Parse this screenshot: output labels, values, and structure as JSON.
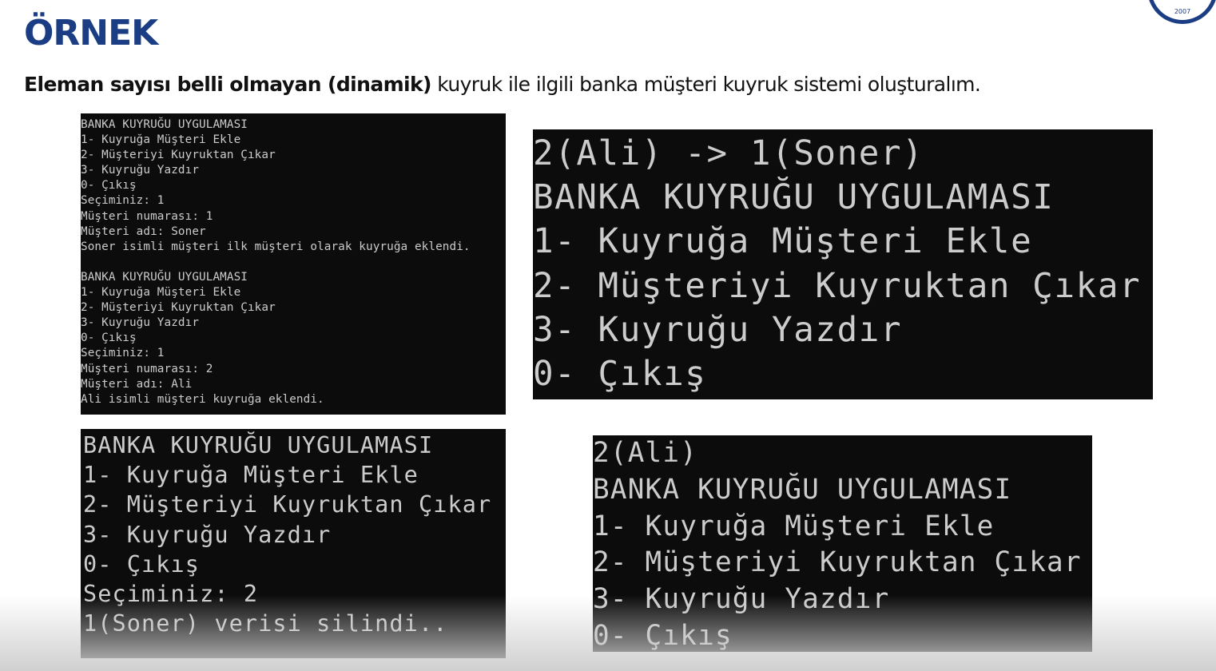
{
  "slide": {
    "title": "ÖRNEK",
    "subtitle_bold": "Eleman sayısı belli olmayan (dinamik)",
    "subtitle_rest": " kuyruk ile ilgili banka müşteri kuyruk sistemi oluşturalım."
  },
  "consoles": [
    {
      "lines": [
        "BANKA KUYRUĞU UYGULAMASI",
        "1- Kuyruğa Müşteri Ekle",
        "2- Müşteriyi Kuyruktan Çıkar",
        "3- Kuyruğu Yazdır",
        "0- Çıkış",
        "Seçiminiz: 1",
        "Müşteri numarası: 1",
        "Müşteri adı: Soner",
        "Soner isimli müşteri ilk müşteri olarak kuyruğa eklendi.",
        "",
        "BANKA KUYRUĞU UYGULAMASI",
        "1- Kuyruğa Müşteri Ekle",
        "2- Müşteriyi Kuyruktan Çıkar",
        "3- Kuyruğu Yazdır",
        "0- Çıkış",
        "Seçiminiz: 1",
        "Müşteri numarası: 2",
        "Müşteri adı: Ali",
        "Ali isimli müşteri kuyruğa eklendi."
      ]
    },
    {
      "lines": [
        "2(Ali) -> 1(Soner)",
        "BANKA KUYRUĞU UYGULAMASI",
        "1- Kuyruğa Müşteri Ekle",
        "2- Müşteriyi Kuyruktan Çıkar",
        "3- Kuyruğu Yazdır",
        "0- Çıkış"
      ]
    },
    {
      "lines": [
        "BANKA KUYRUĞU UYGULAMASI",
        "1- Kuyruğa Müşteri Ekle",
        "2- Müşteriyi Kuyruktan Çıkar",
        "3- Kuyruğu Yazdır",
        "0- Çıkış",
        "Seçiminiz: 2",
        "1(Soner) verisi silindi.."
      ]
    },
    {
      "lines": [
        "2(Ali)",
        "BANKA KUYRUĞU UYGULAMASI",
        "1- Kuyruğa Müşteri Ekle",
        "2- Müşteriyi Kuyruktan Çıkar",
        "3- Kuyruğu Yazdır",
        "0- Çıkış"
      ]
    }
  ],
  "colors": {
    "title": "#1b3d84",
    "console_bg": "#0c0c0c",
    "console_text": "#cccccc"
  }
}
